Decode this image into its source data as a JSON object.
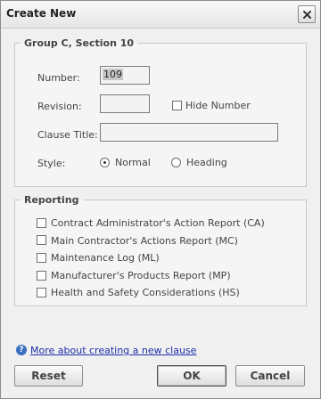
{
  "window": {
    "title": "Create New",
    "close_icon": "close-icon"
  },
  "section": {
    "legend": "Group C, Section 10",
    "number_label": "Number:",
    "number_value": "109",
    "revision_label": "Revision:",
    "revision_value": "",
    "hide_number_label": "Hide Number",
    "hide_number_checked": false,
    "clause_title_label": "Clause Title:",
    "clause_title_value": "",
    "style_label": "Style:",
    "style_options": [
      "Normal",
      "Heading"
    ],
    "style_selected": "Normal"
  },
  "reporting": {
    "legend": "Reporting",
    "items": [
      {
        "label": "Contract Administrator's Action Report (CA)",
        "checked": false
      },
      {
        "label": "Main Contractor's Actions Report (MC)",
        "checked": false
      },
      {
        "label": "Maintenance Log (ML)",
        "checked": false
      },
      {
        "label": "Manufacturer's Products Report (MP)",
        "checked": false
      },
      {
        "label": "Health and Safety Considerations (HS)",
        "checked": false
      }
    ]
  },
  "help": {
    "icon": "help-icon",
    "link_text": "More about creating a new clause"
  },
  "buttons": {
    "reset": "Reset",
    "ok": "OK",
    "cancel": "Cancel"
  }
}
